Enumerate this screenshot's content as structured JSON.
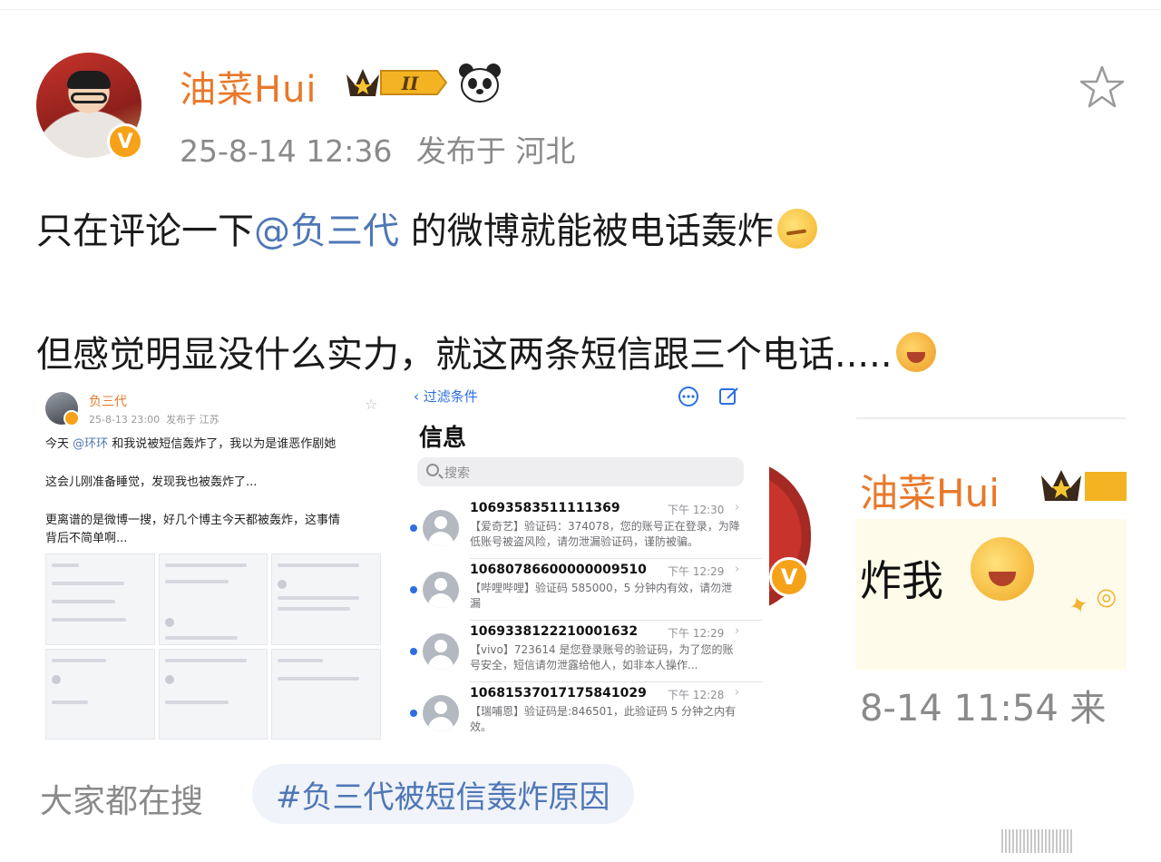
{
  "post": {
    "author": "油菜Hui",
    "level_badge": "II",
    "timestamp": "25-8-14 12:36",
    "location": "发布于 河北",
    "line1_before": "只在评论一下",
    "line1_mention": "@负三代",
    "line1_after": " 的微博就能被电话轰炸",
    "line2": "但感觉明显没什么实力，就这两条短信跟三个电话.....",
    "icons": [
      "verified-v-icon",
      "crown-level-icon",
      "panda-icon",
      "star-icon",
      "thinking-emoji-icon",
      "laughing-emoji-icon"
    ],
    "accent_orange": "#e8792a",
    "link_blue": "#4f77b6"
  },
  "image1": {
    "author": "负三代",
    "timestamp": "25-8-13 23:00",
    "location": "发布于 江苏",
    "line1_before": "今天",
    "line1_mention": "@环环",
    "line1_after": " 和我说被短信轰炸了，我以为是谁恶作剧她",
    "line2": "这会儿刚准备睡觉，发现我也被轰炸了...",
    "line3": "更离谱的是微博一搜，好几个博主今天都被轰炸，这事情",
    "line4": "背后不简单啊..."
  },
  "image2": {
    "back_label": "过滤条件",
    "title": "信息",
    "search_placeholder": "搜索",
    "messages": [
      {
        "sender": "10693583511111369",
        "time": "下午 12:30",
        "body": "【爱奇艺】验证码：374078，您的账号正在登录，为降低账号被盗风险，请勿泄漏验证码，谨防被骗。"
      },
      {
        "sender": "10680786600000009510",
        "time": "下午 12:29",
        "body": "【哔哩哔哩】验证码 585000，5 分钟内有效，请勿泄漏"
      },
      {
        "sender": "1069338122210001632",
        "time": "下午 12:29",
        "body": "【vivo】723614 是您登录账号的验证码，为了您的账号安全，短信请勿泄露给他人，如非本人操作..."
      },
      {
        "sender": "10681537017175841029",
        "time": "下午 12:28",
        "body": "【瑞哺恩】验证码是:846501，此验证码 5 分钟之内有效。"
      }
    ]
  },
  "image3": {
    "author": "油菜Hui",
    "comment": "炸我",
    "time": "8-14 11:54 来"
  },
  "footer": {
    "label": "大家都在搜",
    "hashtag": "#负三代被短信轰炸原因"
  }
}
